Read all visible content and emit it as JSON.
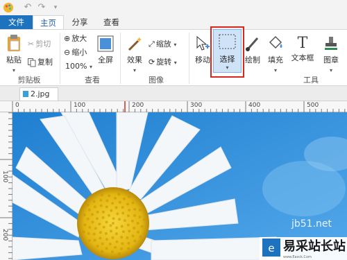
{
  "quick_access": {
    "logo_icon": "paint-app-logo",
    "undo_icon": "undo-icon",
    "redo_icon": "redo-icon",
    "customize_icon": "customize-qat-icon"
  },
  "tabs": [
    {
      "label": "文件"
    },
    {
      "label": "主页"
    },
    {
      "label": "分享"
    },
    {
      "label": "查看"
    }
  ],
  "clipboard": {
    "paste": "粘贴",
    "cut": "剪切",
    "copy": "复制",
    "group": "剪贴板"
  },
  "view": {
    "zoom_in": "放大",
    "zoom_out": "缩小",
    "zoom_level": "100%",
    "fullscreen": "全屏",
    "group": "查看"
  },
  "image": {
    "effects": "效果",
    "resize": "缩放",
    "rotate": "旋转",
    "group": "图像"
  },
  "tools": {
    "move": "移动",
    "select": "选择",
    "draw": "绘制",
    "fill": "填充",
    "text": "文本框",
    "stamp": "图章",
    "group": "工具"
  },
  "document": {
    "tab_name": "2.jpg",
    "close": "×"
  },
  "ruler": {
    "top_marks": [
      "0",
      "100",
      "200",
      "300",
      "400",
      "500"
    ],
    "left_marks": [
      "100",
      "200"
    ]
  },
  "watermark": {
    "site": "易采站长站",
    "url": "www.Easck.Com",
    "partial": "jb51.net"
  },
  "colors": {
    "accent": "#1e73be",
    "selection_highlight": "#d9271f",
    "sky": "#2f8fd8"
  }
}
